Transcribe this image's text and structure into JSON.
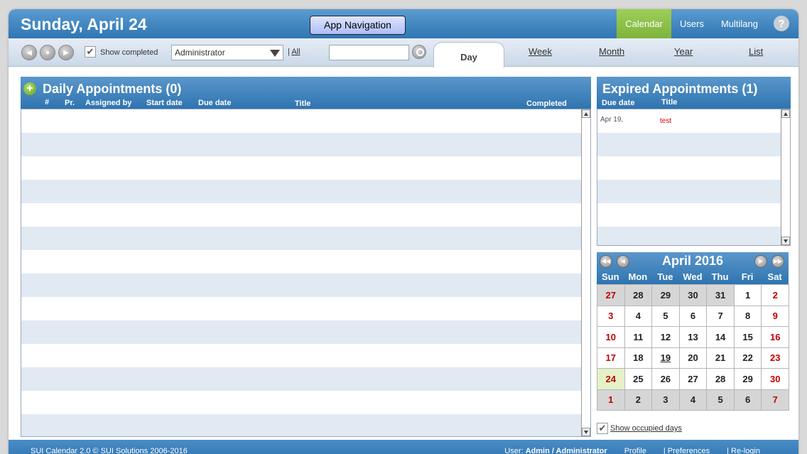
{
  "header": {
    "date": "Sunday, April 24",
    "app_nav": "App Navigation",
    "nav": [
      "Calendar",
      "Users",
      "Multilang"
    ],
    "help": "?"
  },
  "toolbar": {
    "show_completed": "Show completed",
    "user_select": "Administrator",
    "all_link": "All",
    "search_placeholder": "",
    "tabs": [
      "Day",
      "Week",
      "Month",
      "Year",
      "List"
    ]
  },
  "daily": {
    "title": "Daily Appointments (0)",
    "columns": [
      "#",
      "Pr.",
      "Assigned by",
      "Start date",
      "Due date",
      "Title",
      "Completed"
    ]
  },
  "expired": {
    "title": "Expired Appointments (1)",
    "columns": [
      "Due date",
      "Title"
    ],
    "rows": [
      {
        "due": "Apr 19,",
        "title": "test"
      }
    ]
  },
  "calendar": {
    "month_label": "April  2016",
    "weekdays": [
      "Sun",
      "Mon",
      "Tue",
      "Wed",
      "Thu",
      "Fri",
      "Sat"
    ],
    "days": [
      {
        "d": "27",
        "t": "other weekend"
      },
      {
        "d": "28",
        "t": "other"
      },
      {
        "d": "29",
        "t": "other"
      },
      {
        "d": "30",
        "t": "other"
      },
      {
        "d": "31",
        "t": "other"
      },
      {
        "d": "1",
        "t": ""
      },
      {
        "d": "2",
        "t": "weekend"
      },
      {
        "d": "3",
        "t": "weekend"
      },
      {
        "d": "4",
        "t": ""
      },
      {
        "d": "5",
        "t": ""
      },
      {
        "d": "6",
        "t": ""
      },
      {
        "d": "7",
        "t": ""
      },
      {
        "d": "8",
        "t": ""
      },
      {
        "d": "9",
        "t": "weekend"
      },
      {
        "d": "10",
        "t": "weekend"
      },
      {
        "d": "11",
        "t": ""
      },
      {
        "d": "12",
        "t": ""
      },
      {
        "d": "13",
        "t": ""
      },
      {
        "d": "14",
        "t": ""
      },
      {
        "d": "15",
        "t": ""
      },
      {
        "d": "16",
        "t": "weekend"
      },
      {
        "d": "17",
        "t": "weekend"
      },
      {
        "d": "18",
        "t": ""
      },
      {
        "d": "19",
        "t": "has"
      },
      {
        "d": "20",
        "t": ""
      },
      {
        "d": "21",
        "t": ""
      },
      {
        "d": "22",
        "t": ""
      },
      {
        "d": "23",
        "t": "weekend"
      },
      {
        "d": "24",
        "t": "today"
      },
      {
        "d": "25",
        "t": ""
      },
      {
        "d": "26",
        "t": ""
      },
      {
        "d": "27",
        "t": ""
      },
      {
        "d": "28",
        "t": ""
      },
      {
        "d": "29",
        "t": ""
      },
      {
        "d": "30",
        "t": "weekend"
      },
      {
        "d": "1",
        "t": "other weekend"
      },
      {
        "d": "2",
        "t": "other"
      },
      {
        "d": "3",
        "t": "other"
      },
      {
        "d": "4",
        "t": "other"
      },
      {
        "d": "5",
        "t": "other"
      },
      {
        "d": "6",
        "t": "other"
      },
      {
        "d": "7",
        "t": "other weekend"
      }
    ],
    "show_occupied": "Show occupied days"
  },
  "footer": {
    "copyright": "SUI Calendar 2.0 © SUI Solutions 2006-2016",
    "user_prefix": "User:",
    "user": "Admin / Administrator",
    "links": [
      "Profile",
      "| Preferences",
      "| Re-login"
    ]
  }
}
